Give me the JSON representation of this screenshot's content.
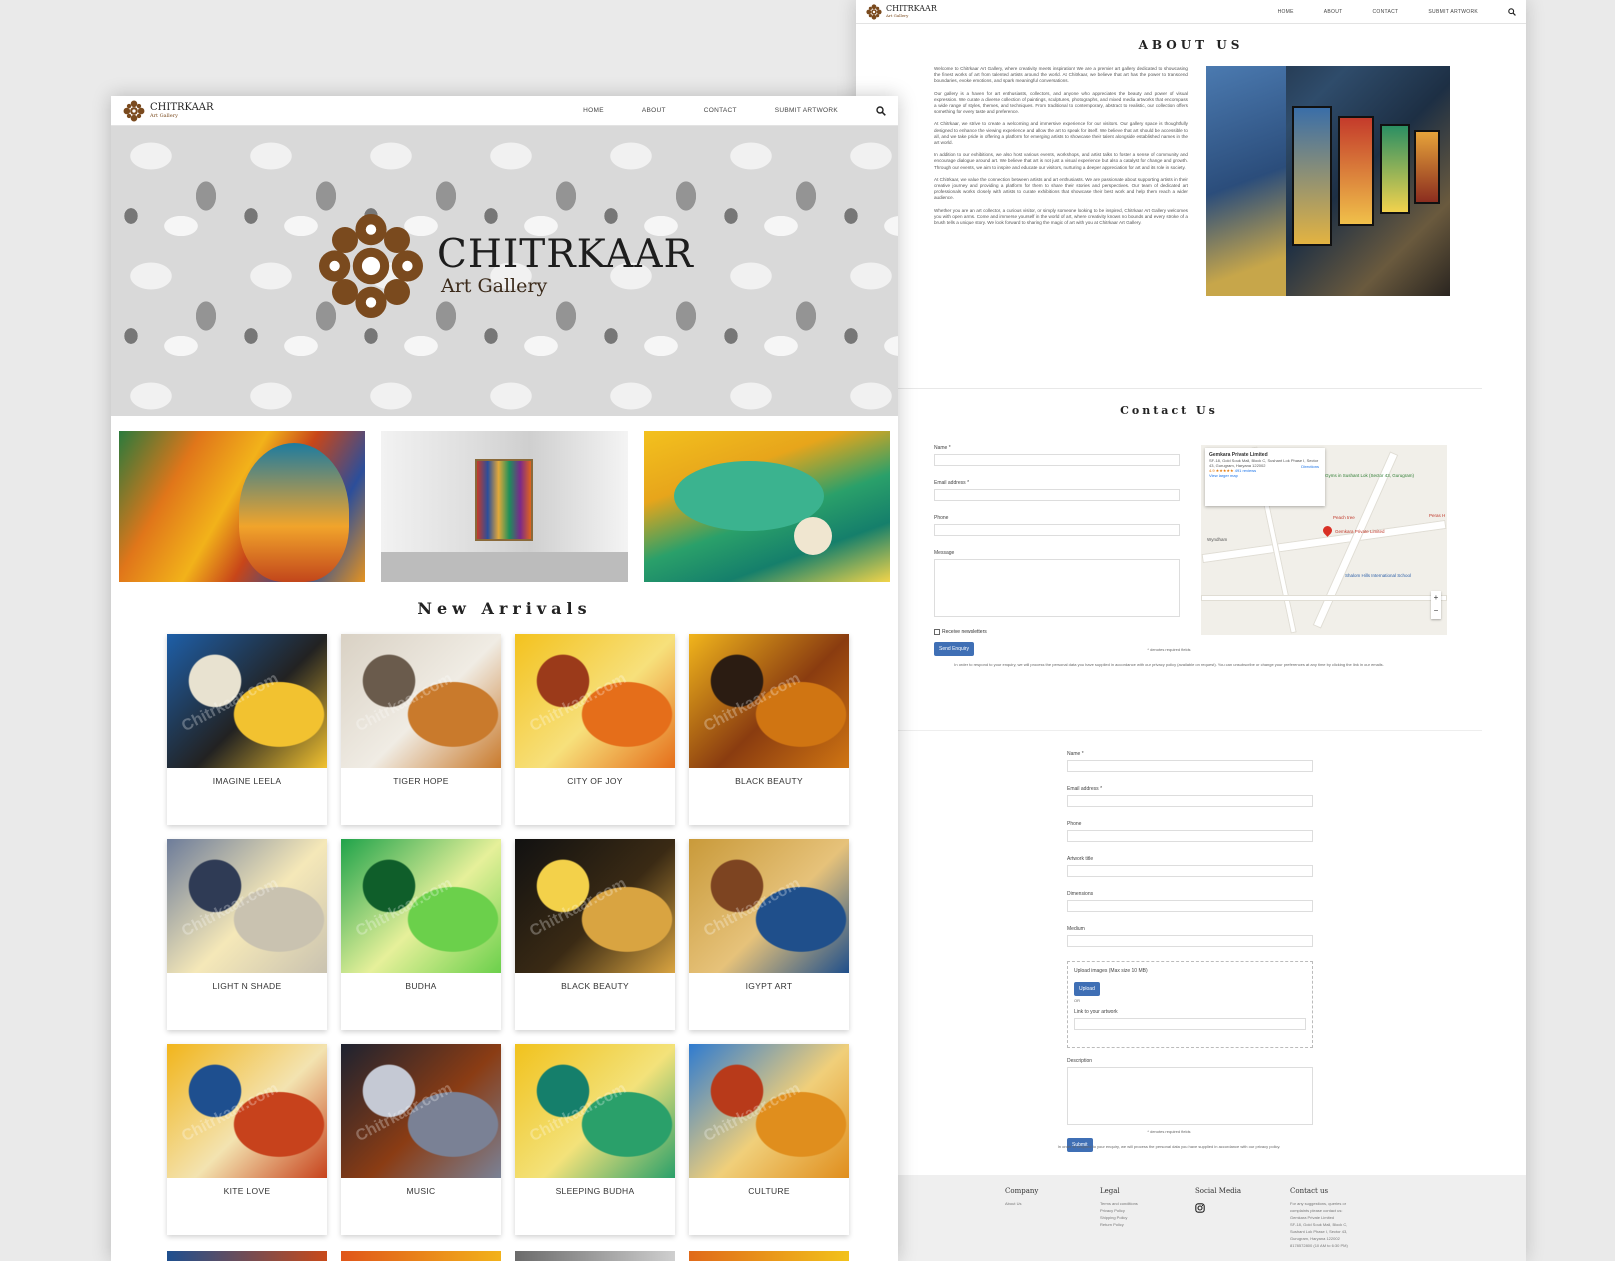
{
  "brand": {
    "name": "CHITRKAAR",
    "tagline": "Art Gallery",
    "accent": "#7a4a1e"
  },
  "nav": {
    "items": [
      "HOME",
      "ABOUT",
      "CONTACT",
      "SUBMIT ARTWORK"
    ]
  },
  "hero": {
    "title": "CHITRKAAR",
    "subtitle": "Art Gallery"
  },
  "featured": [
    {
      "name": "buddha-painting"
    },
    {
      "name": "gallery-interior"
    },
    {
      "name": "sleeping-buddha-lotus"
    }
  ],
  "new_arrivals": {
    "title": "New Arrivals",
    "watermark": "Chitrkaar.com",
    "items": [
      {
        "title": "IMAGINE LEELA",
        "colors": [
          "#1e5fa8",
          "#f2c230",
          "#e8e2d0",
          "#222"
        ]
      },
      {
        "title": "TIGER HOPE",
        "colors": [
          "#d9d1c4",
          "#c97a2c",
          "#6a5b4c",
          "#f0ece4"
        ]
      },
      {
        "title": "CITY OF JOY",
        "colors": [
          "#f3c21e",
          "#e56e1a",
          "#9b3a1a",
          "#f7e07b"
        ]
      },
      {
        "title": "BLACK BEAUTY",
        "colors": [
          "#f1b51c",
          "#d07512",
          "#2b1c12",
          "#8a3c10"
        ]
      },
      {
        "title": "LIGHT N SHADE",
        "colors": [
          "#6d7c9a",
          "#c9c2b0",
          "#2f3b55",
          "#f5e8b8"
        ]
      },
      {
        "title": "BUDHA",
        "colors": [
          "#1fa34a",
          "#6bd04b",
          "#0f5e2a",
          "#e6f09a"
        ]
      },
      {
        "title": "BLACK BEAUTY",
        "colors": [
          "#111",
          "#d9a441",
          "#f3d14a",
          "#3a2a14"
        ]
      },
      {
        "title": "IGYPT ART",
        "colors": [
          "#c99a3a",
          "#1f4f8b",
          "#7d4421",
          "#e6c27a"
        ]
      },
      {
        "title": "KITE LOVE",
        "colors": [
          "#f2b51b",
          "#c7421c",
          "#1e4f8f",
          "#f3e3b0"
        ]
      },
      {
        "title": "MUSIC",
        "colors": [
          "#1d2230",
          "#7a8195",
          "#c5c9d4",
          "#8a3c14"
        ]
      },
      {
        "title": "SLEEPING BUDHA",
        "colors": [
          "#f1c21d",
          "#2aa06a",
          "#157f6b",
          "#f3e27a"
        ]
      },
      {
        "title": "CULTURE",
        "colors": [
          "#2f7bd0",
          "#e08e1d",
          "#b83a1a",
          "#f0cf7a"
        ]
      }
    ]
  },
  "about": {
    "title": "ABOUT US",
    "paragraphs": [
      "Welcome to Chitrkaar Art Gallery, where creativity meets inspiration! We are a premier art gallery dedicated to showcasing the finest works of art from talented artists around the world. At Chitrkaar, we believe that art has the power to transcend boundaries, evoke emotions, and spark meaningful conversations.",
      "Our gallery is a haven for art enthusiasts, collectors, and anyone who appreciates the beauty and power of visual expression. We curate a diverse collection of paintings, sculptures, photographs, and mixed media artworks that encompass a wide range of styles, themes, and techniques. From traditional to contemporary, abstract to realistic, our collection offers something for every taste and preference.",
      "At Chitrkaar, we strive to create a welcoming and immersive experience for our visitors. Our gallery space is thoughtfully designed to enhance the viewing experience and allow the art to speak for itself. We believe that art should be accessible to all, and we take pride in offering a platform for emerging artists to showcase their talent alongside established names in the art world.",
      "In addition to our exhibitions, we also host various events, workshops, and artist talks to foster a sense of community and encourage dialogue around art. We believe that art is not just a visual experience but also a catalyst for change and growth. Through our events, we aim to inspire and educate our visitors, nurturing a deeper appreciation for art and its role in society.",
      "At Chitrkaar, we value the connection between artists and art enthusiasts. We are passionate about supporting artists in their creative journey and providing a platform for them to share their stories and perspectives. Our team of dedicated art professionals works closely with artists to curate exhibitions that showcase their best work and help them reach a wider audience.",
      "Whether you are an art collector, a curious visitor, or simply someone looking to be inspired, Chitrkaar Art Gallery welcomes you with open arms. Come and immerse yourself in the world of art, where creativity knows no bounds and every stroke of a brush tells a unique story. We look forward to sharing the magic of art with you at Chitrkaar Art Gallery."
    ]
  },
  "contact": {
    "title": "Contact Us",
    "fields": {
      "name": "Name *",
      "email": "Email address *",
      "phone": "Phone",
      "message": "Message"
    },
    "newsletter": "Receive newsletters",
    "send": "Send Enquiry",
    "required_note": "* denotes required fields",
    "privacy": "In order to respond to your enquiry, we will process the personal data you have supplied in accordance with our privacy policy (available on request). You can unsubscribe or change your preferences at any time by clicking the link in our emails.",
    "map": {
      "place": "Gemkara Private Limited",
      "address": "SF-18, Gold Souk Mall, Block C, Sushant Lok Phase I, Sector 43, Gurugram, Haryana 122002",
      "rating": "4.9 ★★★★★",
      "reviews": "491 reviews",
      "directions": "Directions",
      "larger": "View larger map",
      "labels": [
        "Gyms in Sushant Lok (Sector 43, Gurugram)",
        "Peach tree",
        "Gemkara Private Limited",
        "Shalom Hills International School",
        "Wyndham",
        "Peras H"
      ],
      "zoom_in": "+",
      "zoom_out": "−"
    }
  },
  "submit_artwork": {
    "fields": {
      "name": "Name *",
      "email": "Email address *",
      "phone": "Phone",
      "title": "Artwork title",
      "dimensions": "Dimensions",
      "medium": "Medium",
      "upload": "Upload images (Max size 10 MB)",
      "upload_btn": "Upload",
      "or": "OR",
      "link": "Link to your artwork",
      "description": "Description"
    },
    "submit": "Submit",
    "required_note": "* denotes required fields",
    "privacy": "In order to respond to your enquiry, we will process the personal data you have supplied in accordance with our privacy policy."
  },
  "footer": {
    "company": {
      "heading": "Company",
      "links": [
        "About Us"
      ]
    },
    "legal": {
      "heading": "Legal",
      "links": [
        "Terms and conditions",
        "Privacy Policy",
        "Shipping Policy",
        "Return Policy"
      ]
    },
    "social": {
      "heading": "Social Media",
      "icon": "instagram-icon"
    },
    "contact": {
      "heading": "Contact us",
      "lines": [
        "For any suggestions, queries or",
        "complaints please contact us:",
        "Gemkara Private Limited",
        "SF-18, Gold Souk Mall, Block C,",
        "Sushant Lok Phase I, Sector 43,",
        "Gurugram, Haryana 122002",
        "8178572800 (10 AM to 6:30 PM)"
      ]
    }
  }
}
